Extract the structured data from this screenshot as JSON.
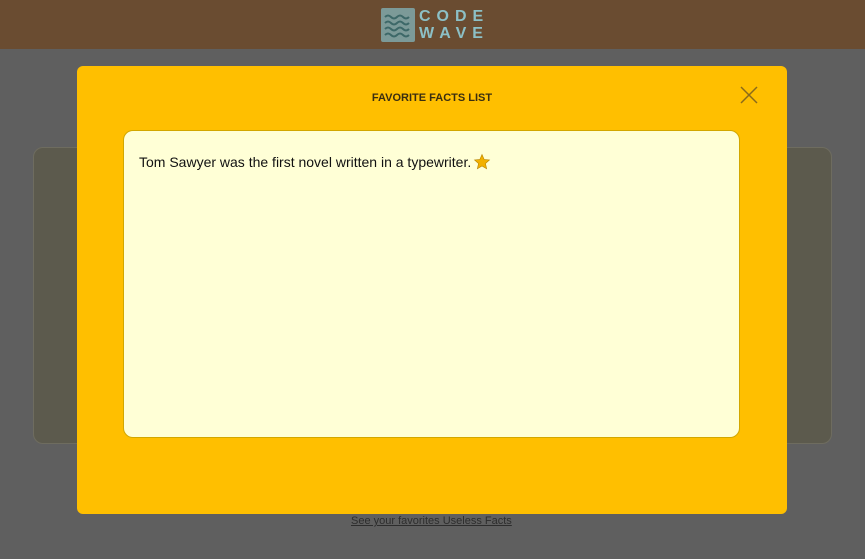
{
  "header": {
    "logo_line1": "CODE",
    "logo_line2": "WAVE"
  },
  "page": {
    "favorites_link": "See your favorites Useless Facts"
  },
  "modal": {
    "title": "FAVORITE FACTS LIST",
    "facts": [
      {
        "text": "Tom Sawyer was the first novel written in a typewriter.",
        "icon": "star-icon",
        "color": "#f2b000"
      }
    ]
  },
  "colors": {
    "header": "#6a4c31",
    "modal": "#ffbf00",
    "list_background": "#ffffd6",
    "logo_text": "#8cc0c6"
  }
}
